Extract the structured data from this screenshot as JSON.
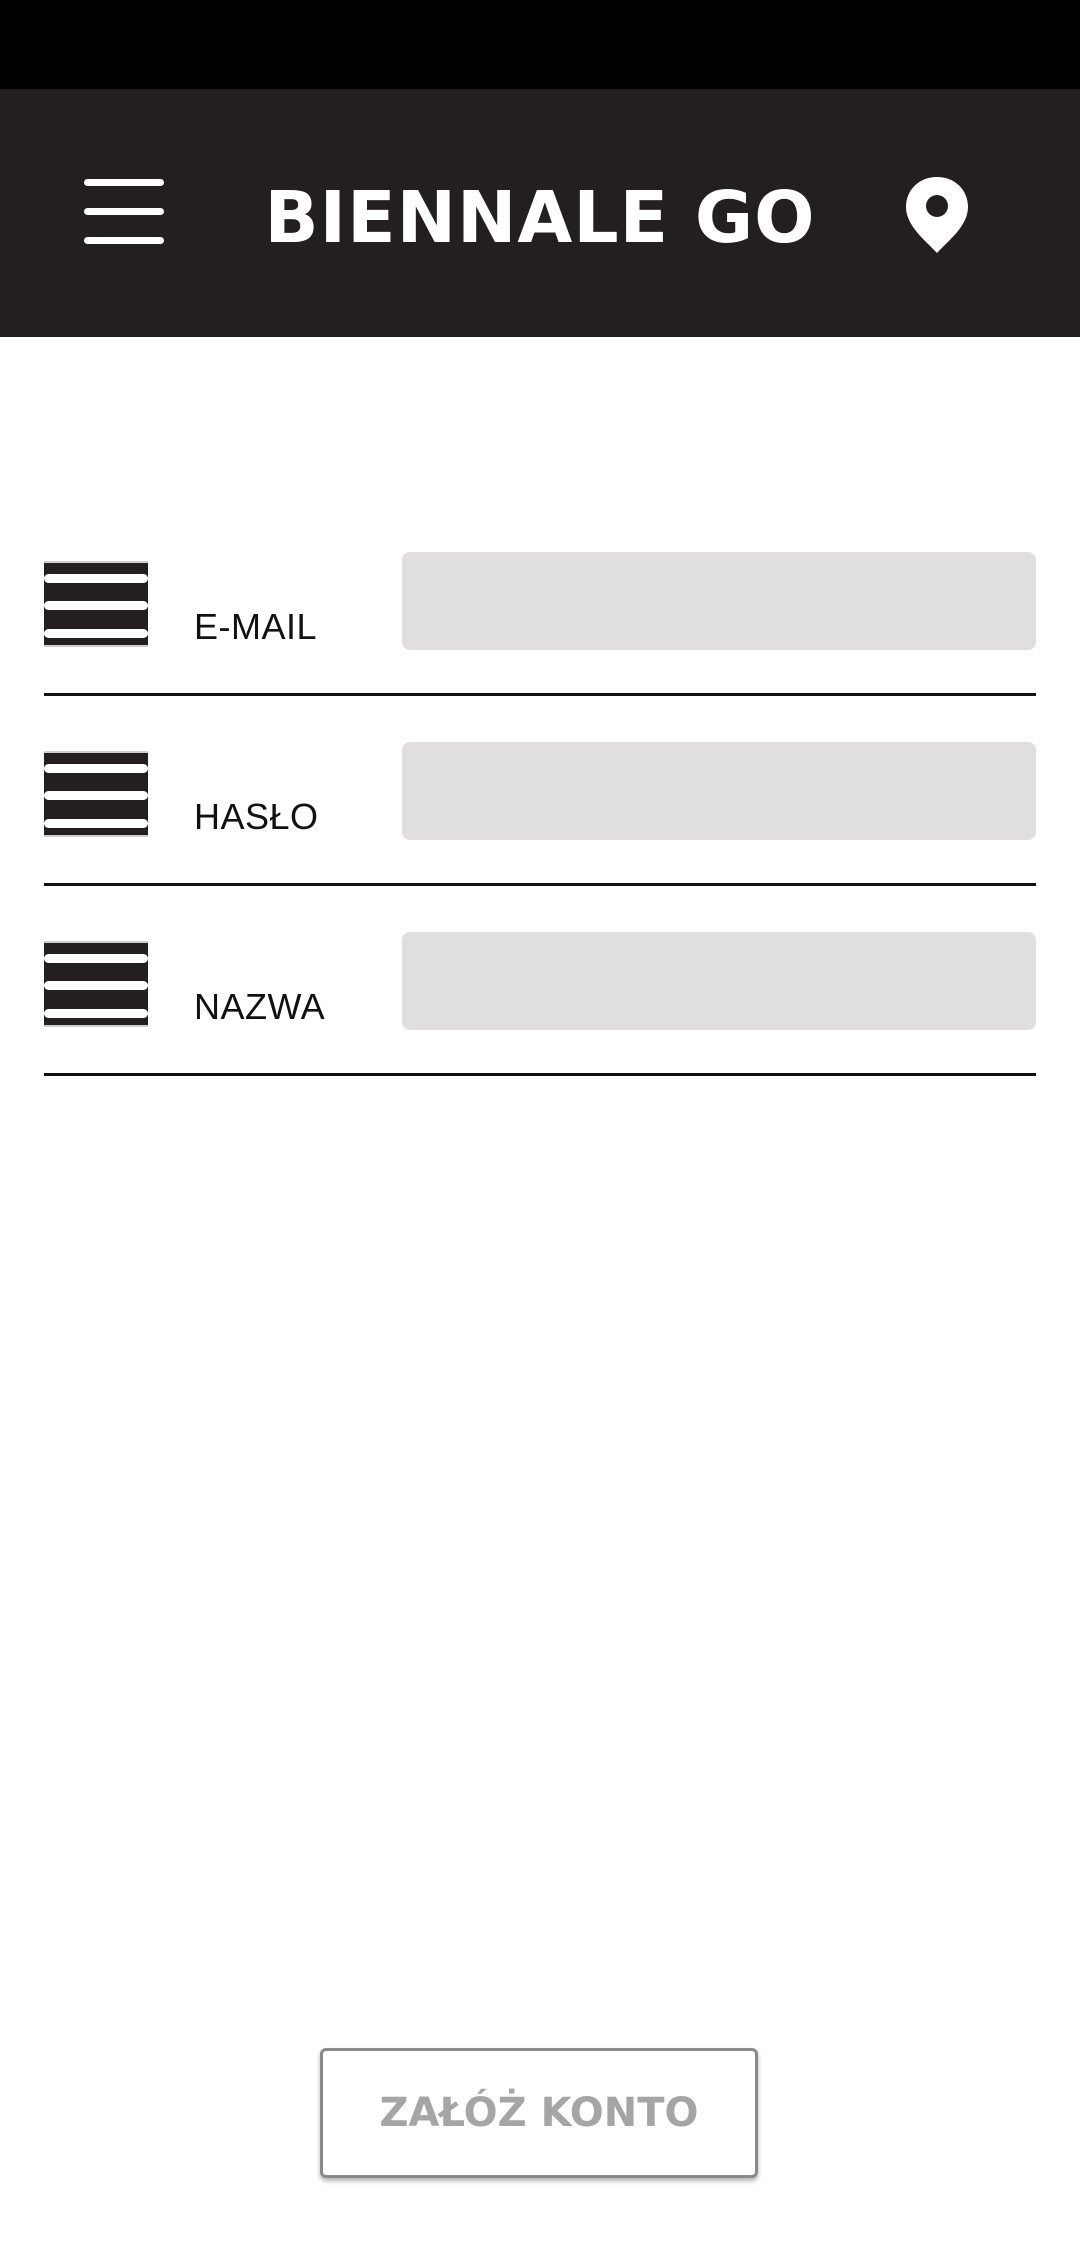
{
  "app_bar": {
    "title": "BIENNALE GO",
    "menu_icon": "hamburger-menu-icon",
    "location_icon": "map-pin-icon"
  },
  "form": {
    "fields": [
      {
        "label": "E-MAIL",
        "value": "",
        "icon": "equals-bars-icon"
      },
      {
        "label": "HASŁO",
        "value": "",
        "icon": "equals-bars-icon"
      },
      {
        "label": "NAZWA",
        "value": "",
        "icon": "equals-bars-icon"
      }
    ]
  },
  "actions": {
    "register_label": "ZAŁÓŻ KONTO"
  },
  "colors": {
    "status_bar": "#000000",
    "app_bar": "#231f20",
    "input_background": "#e1dedf",
    "button_text_disabled": "#a5a5a5"
  }
}
